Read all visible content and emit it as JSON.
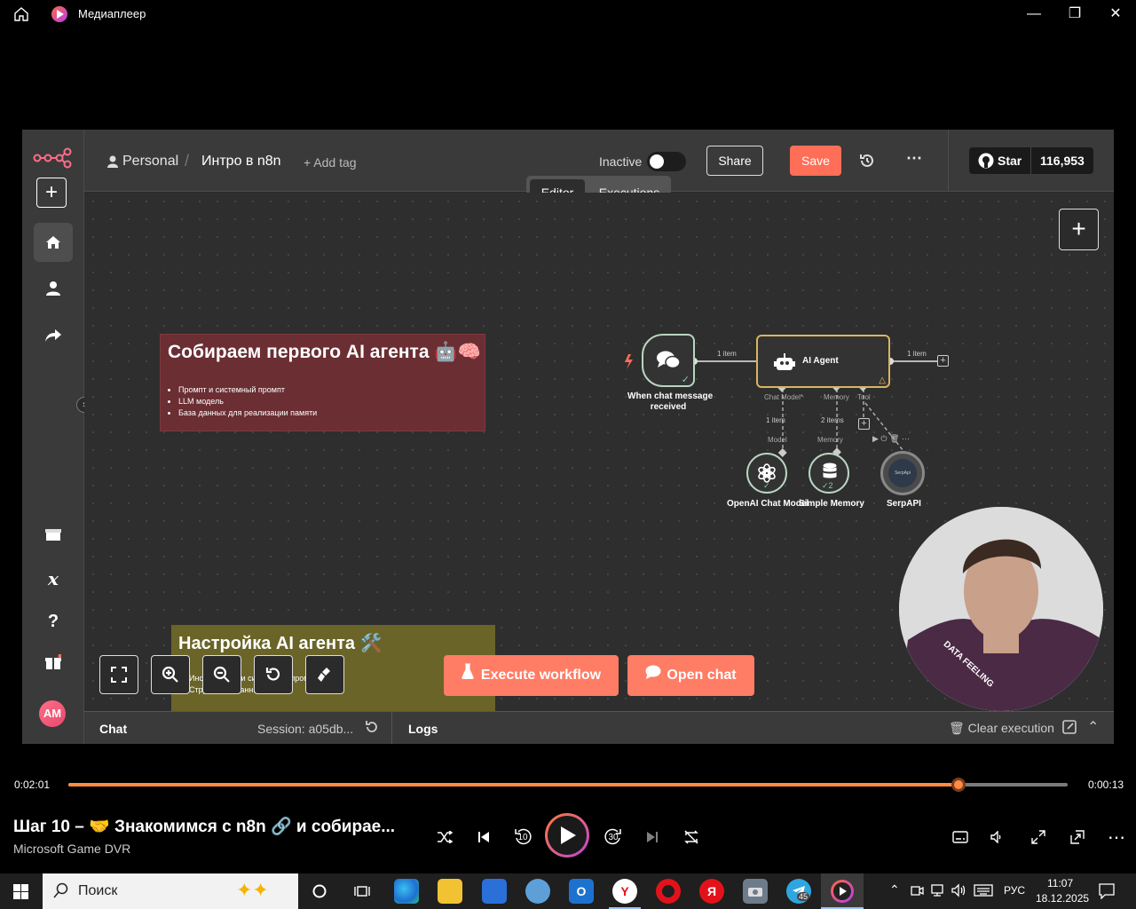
{
  "window": {
    "title": "Медиаплеер"
  },
  "n8n": {
    "breadcrumb": {
      "project": "Personal",
      "workflow": "Интро в n8n",
      "add_tag": "+ Add tag"
    },
    "status_label": "Inactive",
    "share_label": "Share",
    "save_label": "Save",
    "tabs": {
      "editor": "Editor",
      "executions": "Executions"
    },
    "github": {
      "star_label": "Star",
      "star_count": "116,953"
    },
    "sticky1": {
      "title": "Собираем первого AI агента 🤖🧠",
      "items": [
        "Промпт и системный промпт",
        "LLM модель",
        "База данных для реализации памяти"
      ]
    },
    "sticky2": {
      "title": "Настройка AI агента 🛠️",
      "items": [
        "Инструменты и системный промпт",
        "Структурированный ответ"
      ]
    },
    "nodes": {
      "trigger": {
        "label_line1": "When chat message",
        "label_line2": "received"
      },
      "agent": {
        "label": "AI Agent"
      },
      "openai": {
        "label": "OpenAI Chat Model"
      },
      "memory": {
        "label": "Simple Memory",
        "badge": "2"
      },
      "serp": {
        "label": "SerpAPI",
        "inner": "SerpApi"
      }
    },
    "connections": {
      "trigger_agent": "1 item",
      "agent_out": "1 item",
      "model_items": "1 item",
      "memory_items": "2 items",
      "port_chat_model": "Chat Model*",
      "port_memory": "Memory",
      "port_tool": "Tool",
      "in_model": "Model",
      "in_memory": "Memory"
    },
    "execute_label": "Execute workflow",
    "open_chat_label": "Open chat",
    "bottom": {
      "chat": "Chat",
      "session": "Session: a05db...",
      "logs": "Logs",
      "clear": "Clear execution"
    },
    "user_initials": "AM"
  },
  "webcam": {
    "shirt_text": "DATA FEELING"
  },
  "player": {
    "current_time": "0:02:01",
    "remaining_time": "0:00:13",
    "progress": 0.891,
    "video_title": "Шаг 10 – 🤝 Знакомимся с n8n 🔗 и собирае...",
    "source": "Microsoft Game DVR",
    "skip_back": "10",
    "skip_forward": "30"
  },
  "taskbar": {
    "search_placeholder": "Поиск",
    "language": "РУС",
    "time": "11:07",
    "date": "18.12.2025",
    "telegram_badge": "45"
  }
}
